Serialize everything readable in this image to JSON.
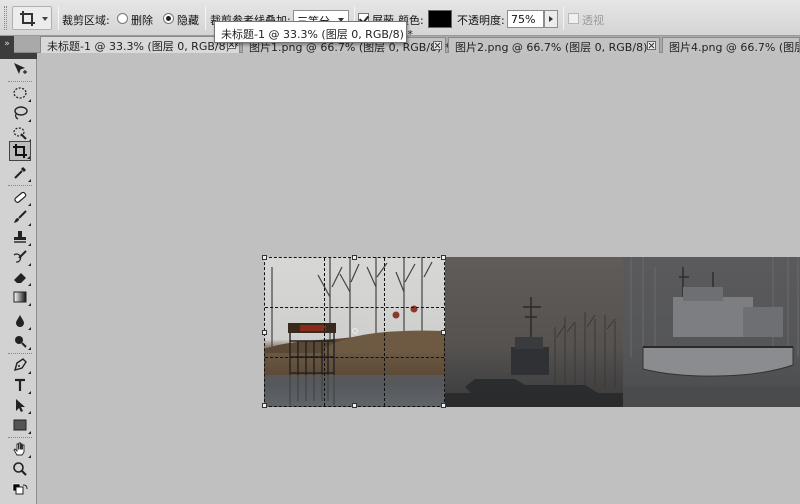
{
  "options_bar": {
    "crop_area_label": "裁剪区域:",
    "delete_label": "删除",
    "hide_label": "隐藏",
    "overlay_label": "裁剪参考线叠加:",
    "overlay_value": "三等分",
    "shield_label": "屏蔽",
    "color_label": "颜色:",
    "shield_color": "#000000",
    "opacity_label": "不透明度:",
    "opacity_value": "75%",
    "perspective_label": "透视",
    "selected_crop_mode": "隐藏"
  },
  "tooltip": {
    "text": "未标题-1 @ 33.3% (图层 0, RGB/8) *"
  },
  "tabs": [
    {
      "label": "未标题-1 @ 33.3% (图层 0, RGB/8) *",
      "active": true
    },
    {
      "label": "图片1.png @ 66.7% (图层 0, RGB/8) *",
      "active": false
    },
    {
      "label": "图片2.png @ 66.7% (图层 0, RGB/8)",
      "active": false
    },
    {
      "label": "图片4.png @ 66.7% (图层 0, RGB/8)",
      "active": false
    }
  ],
  "toolbox": {
    "selected_tool": "crop-tool-icon"
  },
  "colors": {
    "workspace": "#c0c0c0",
    "toolbar": "#d2d2d2",
    "crop_border": "#111111"
  }
}
